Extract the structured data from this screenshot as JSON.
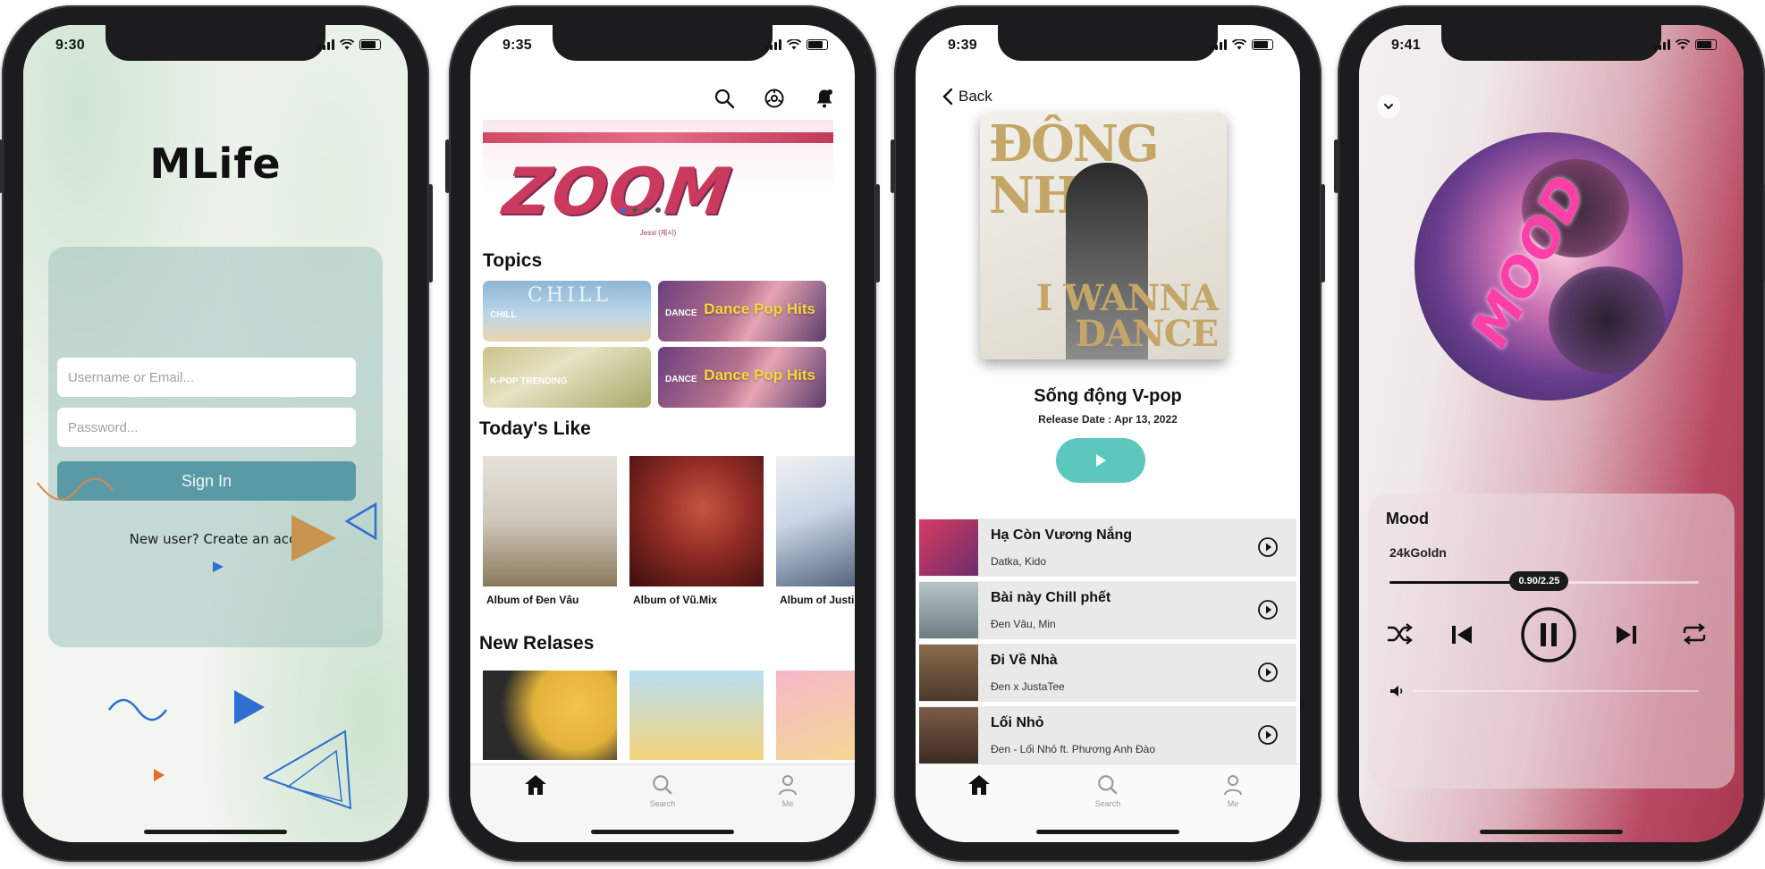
{
  "login": {
    "time": "9:30",
    "app_title": "MLife",
    "username_placeholder": "Username or Email...",
    "password_placeholder": "Password...",
    "signin_label": "Sign In",
    "signup_prompt": "New user? Create an account"
  },
  "home": {
    "time": "9:35",
    "banner": {
      "title": "ZOOM",
      "subtitle": "Jessi (제시)"
    },
    "carousel": {
      "pages": 4,
      "active": 1
    },
    "topics_heading": "Topics",
    "topics": [
      {
        "small": "CHILL",
        "big": ""
      },
      {
        "small": "DANCE",
        "big": "Dance Pop Hits"
      },
      {
        "small": "K-POP TRENDING",
        "big": ""
      },
      {
        "small": "DANCE",
        "big": "Dance Pop Hits"
      }
    ],
    "todays_like_heading": "Today's Like",
    "albums": [
      "Album of Đen Vâu",
      "Album of Vũ.Mix",
      "Album of Justin Bieber"
    ],
    "new_releases_heading": "New Relases",
    "tabs": [
      {
        "label": "Home",
        "icon": "house-icon"
      },
      {
        "label": "Search",
        "icon": "magnifier-icon"
      },
      {
        "label": "Me",
        "icon": "person-icon"
      }
    ]
  },
  "album": {
    "time": "9:39",
    "back_label": "Back",
    "cover_top": "ĐÔNG NHI",
    "cover_bottom": "I WANNA DANCE",
    "title": "Sống động V-pop",
    "release": "Release Date : Apr 13, 2022",
    "tracks": [
      {
        "name": "Hạ Còn Vương Nắng",
        "artist": "Datka, Kido"
      },
      {
        "name": "Bài này Chill phết",
        "artist": "Đen Vâu, Min"
      },
      {
        "name": "Đi Về Nhà",
        "artist": "Đen x JustaTee"
      },
      {
        "name": "Lối Nhỏ",
        "artist": "Đen - Lối Nhỏ ft. Phương Anh Đào"
      }
    ],
    "tabs": [
      {
        "label": "Home",
        "icon": "house-icon"
      },
      {
        "label": "Search",
        "icon": "magnifier-icon"
      },
      {
        "label": "Me",
        "icon": "person-icon"
      }
    ]
  },
  "player": {
    "time": "9:41",
    "song": "Mood",
    "artist": "24kGoldn",
    "cover_text": "MOOD",
    "position_label": "0.90/2.25",
    "progress_fraction": 0.4,
    "volume_fraction": 0.0,
    "accent": "#a8384f"
  },
  "colors": {
    "signin_bg": "#5a9aa6",
    "play_button": "#5cc7bd",
    "track_row": "#e9e9e9"
  }
}
